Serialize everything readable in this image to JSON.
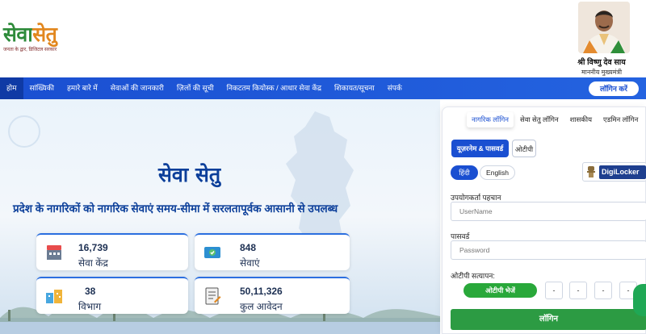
{
  "header": {
    "logo_main": "सेवा",
    "logo_accent": "सेतु",
    "logo_tagline": "जनता के द्वार, डिजिटल सरकार",
    "cm_name": "श्री विष्णु देव साय",
    "cm_title": "माननीय मुख्यमंत्री"
  },
  "nav": {
    "items": [
      "होम",
      "सांख्यिकी",
      "हमारे बारे में",
      "सेवाओं की जानकारी",
      "ज़िलों की सूची",
      "निकटतम कियोस्क / आधार सेवा केंद्र",
      "शिकायत/सूचना",
      "संपर्क"
    ],
    "login_button": "लॉगिन करें"
  },
  "hero": {
    "title": "सेवा सेतु",
    "subtitle": "प्रदेश के नागरिकों को नागरिक सेवाएं समय-सीमा में सरलतापूर्वक आसानी से उपलब्ध",
    "stats": [
      {
        "value": "16,739",
        "label": "सेवा केंद्र",
        "icon": "building-icon"
      },
      {
        "value": "848",
        "label": "सेवाएं",
        "icon": "services-icon"
      },
      {
        "value": "38",
        "label": "विभाग",
        "icon": "department-icon"
      },
      {
        "value": "50,11,326",
        "label": "कुल आवेदन",
        "icon": "application-icon"
      }
    ]
  },
  "login_panel": {
    "tabs": [
      "नागरिक लॉगिन",
      "सेवा सेतु लॉगिन",
      "शासकीय",
      "एडमिन लॉगिन"
    ],
    "mode_username": "यूज़रनेम & पासवर्ड",
    "mode_otp": "ओटीपी",
    "lang_hindi": "हिंदी",
    "lang_english": "English",
    "digilocker": "DigiLocker",
    "username_label": "उपयोगकर्ता पहचान",
    "username_placeholder": "UserName",
    "password_label": "पासवर्ड",
    "password_placeholder": "Password",
    "otp_label": "ओटीपी सत्यापन:",
    "otp_send": "ओटीपी भेजें",
    "otp_digits": [
      "-",
      "-",
      "-",
      "-"
    ],
    "submit": "लॉगिन"
  },
  "colors": {
    "nav_blue": "#1a4fd1",
    "brand_green": "#2e8b3a",
    "accent_orange": "#e2871e",
    "submit_green": "#2c9b43",
    "title_blue": "#0c3f9a"
  }
}
